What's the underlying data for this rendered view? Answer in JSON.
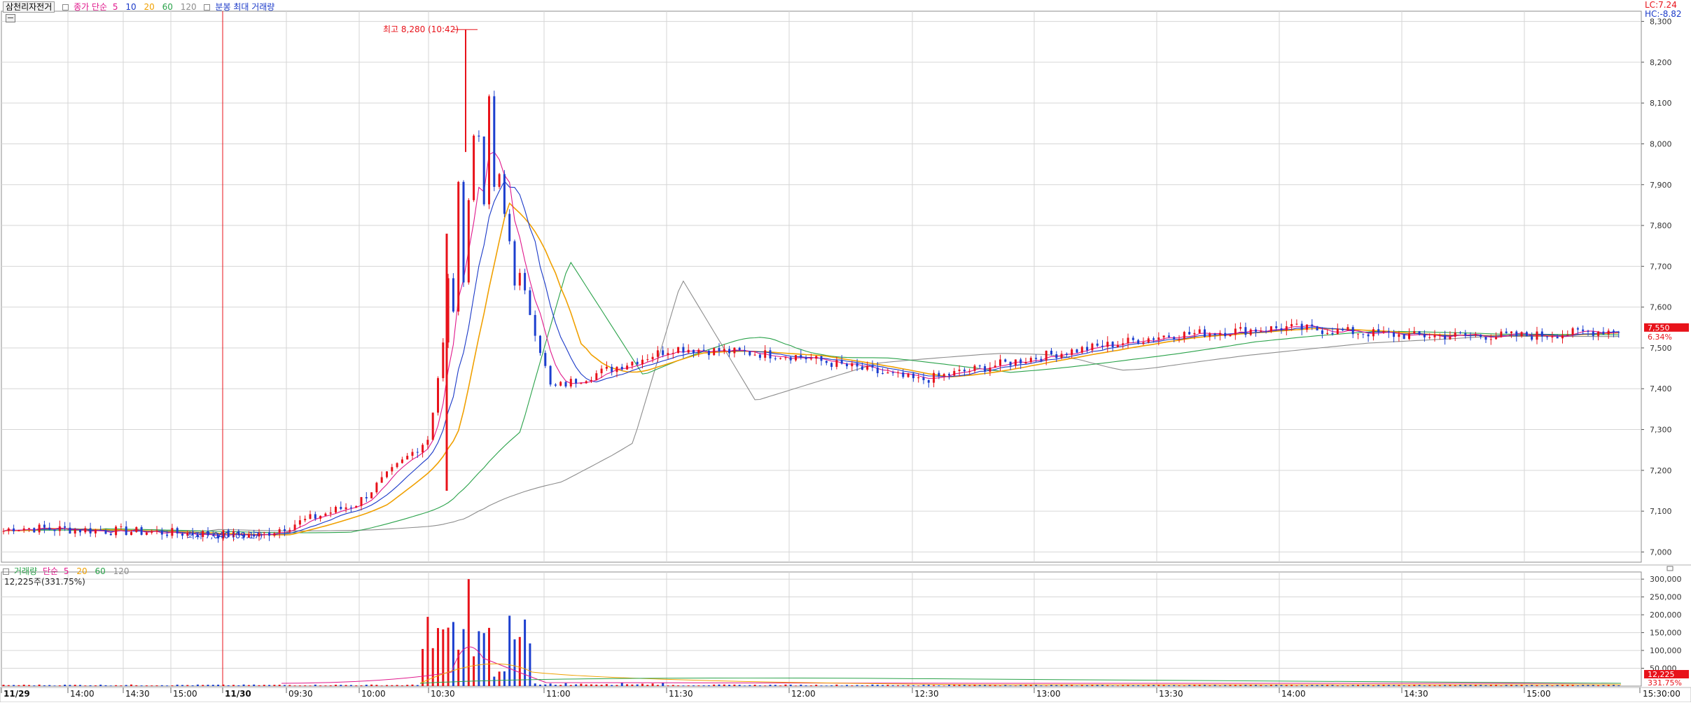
{
  "price_legend": {
    "title": "삼천리자전거",
    "ma_group": "종가 단순",
    "ma_periods": [
      "5",
      "10",
      "20",
      "60",
      "120"
    ],
    "extra": "분봉 최대 거래량"
  },
  "volume_legend": {
    "title": "거래량",
    "ma_group": "단순",
    "ma_periods": [
      "5",
      "20",
      "60",
      "120"
    ],
    "current": "12,225주(331.75%)"
  },
  "corner_info": {
    "lc": "LC:7.24",
    "hc": "HC:-8.82"
  },
  "annotations": {
    "high": "최고 8,280 (10:42)",
    "low": "최저 7,040 (09:17)"
  },
  "price_tag": {
    "price": "7,550",
    "change": "6.34%"
  },
  "volume_tag": {
    "value": "12,225",
    "ratio": "331.75%"
  },
  "colors": {
    "up": "#e8121a",
    "down": "#1c3fcf",
    "ma5": "#e0188c",
    "ma10": "#1a39c8",
    "ma20": "#f0a000",
    "ma60": "#2aa24a",
    "ma120": "#8c8c8c",
    "grid": "#d6d6d6",
    "frame": "#8c8c8c"
  },
  "chart_data": [
    {
      "type": "candlestick",
      "title": "삼천리자전거",
      "ylim": [
        6975,
        8325
      ],
      "y_ticks": [
        "7,000",
        "7,100",
        "7,200",
        "7,300",
        "7,400",
        "7,500",
        "7,600",
        "7,700",
        "7,800",
        "7,900",
        "8,000",
        "8,100",
        "8,200",
        "8,300"
      ],
      "x_ticks": [
        "11/29",
        "14:00",
        "14:30",
        "15:00",
        "11/30",
        "09:30",
        "10:00",
        "10:30",
        "11:00",
        "11:30",
        "12:00",
        "12:30",
        "13:00",
        "13:30",
        "14:00",
        "14:30",
        "15:00",
        "15:30:00"
      ],
      "moving_averages": [
        "5",
        "10",
        "20",
        "60",
        "120"
      ],
      "high": {
        "time": "10:42",
        "value": 8280
      },
      "low": {
        "time": "09:17",
        "value": 7040
      },
      "last": 7550,
      "key_points": [
        {
          "t": "11/29 13:30",
          "close": 7060
        },
        {
          "t": "11/30 09:17",
          "close": 7040
        },
        {
          "t": "10:00",
          "close": 7120
        },
        {
          "t": "10:30",
          "close": 7280
        },
        {
          "t": "10:42",
          "close": 8050
        },
        {
          "t": "11:00",
          "close": 7400
        },
        {
          "t": "11:30",
          "close": 7500
        },
        {
          "t": "12:00",
          "close": 7480
        },
        {
          "t": "12:30",
          "close": 7420
        },
        {
          "t": "13:00",
          "close": 7480
        },
        {
          "t": "13:30",
          "close": 7530
        },
        {
          "t": "14:00",
          "close": 7550
        },
        {
          "t": "14:30",
          "close": 7530
        },
        {
          "t": "15:00",
          "close": 7530
        },
        {
          "t": "15:30",
          "close": 7550
        }
      ]
    },
    {
      "type": "bar",
      "title": "거래량",
      "ylim": [
        0,
        320000
      ],
      "y_ticks": [
        "50,000",
        "100,000",
        "150,000",
        "200,000",
        "250,000",
        "300,000"
      ],
      "moving_averages": [
        "5",
        "20",
        "60",
        "120"
      ],
      "last": 12225
    }
  ]
}
